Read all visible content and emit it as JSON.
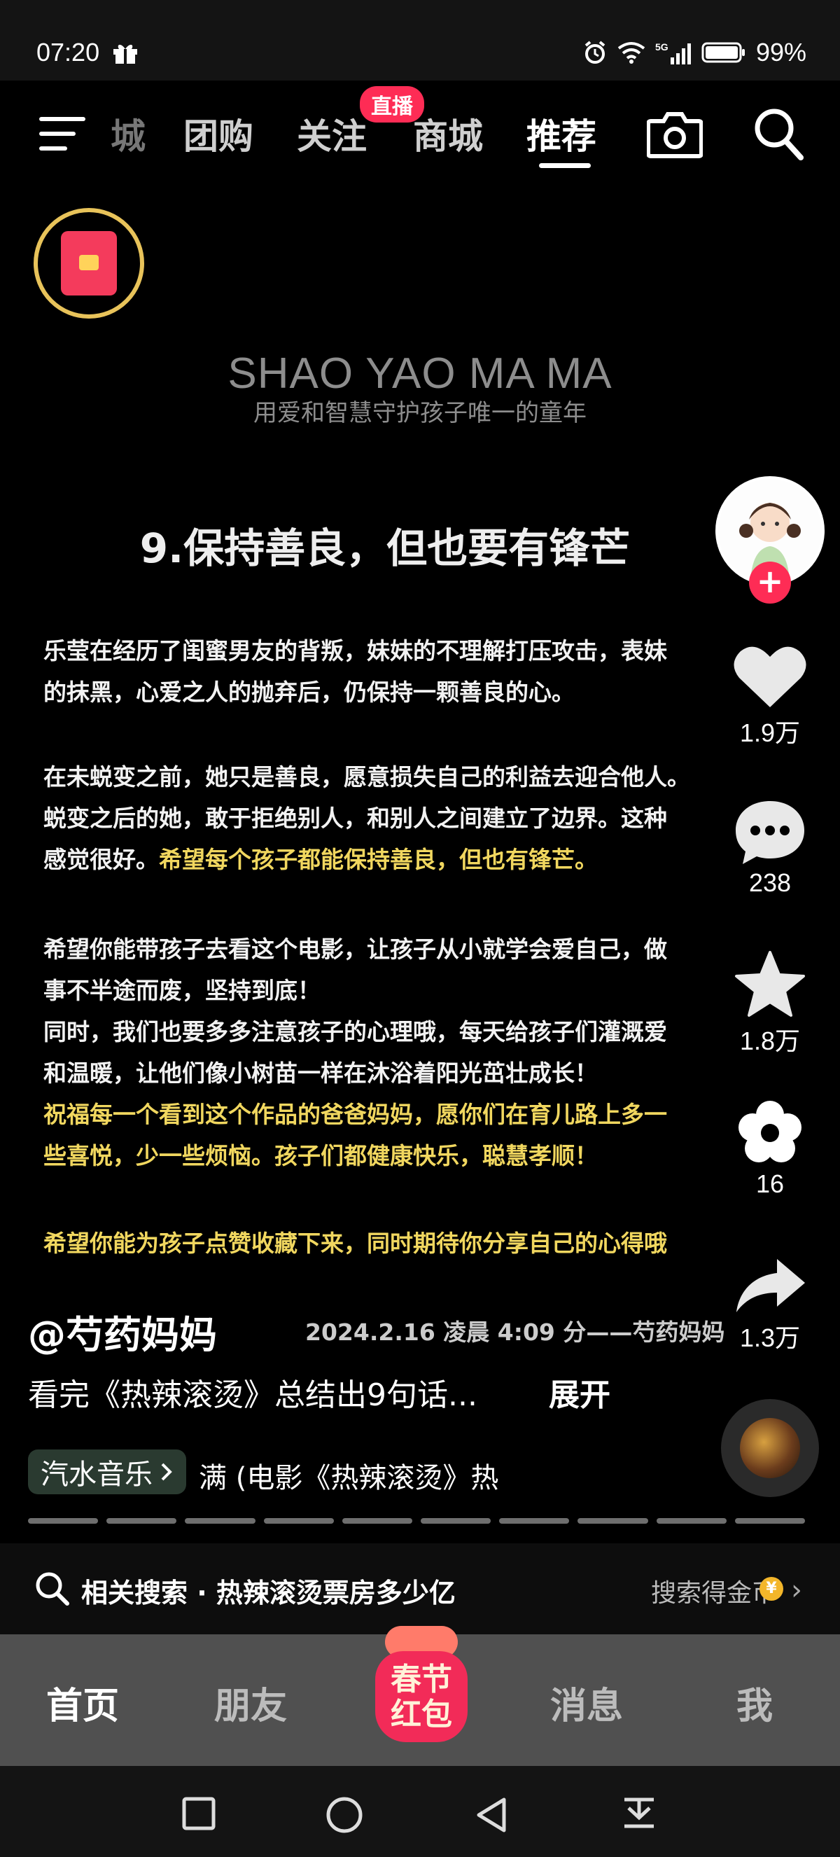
{
  "status_bar": {
    "time": "07:20",
    "battery": "99%",
    "network": "5G"
  },
  "top_nav": {
    "tabs": [
      "城",
      "团购",
      "关注",
      "商城",
      "推荐"
    ],
    "active_tab": "推荐",
    "live_badge": "直播"
  },
  "post": {
    "brand_title": "SHAO YAO MA MA",
    "brand_subtitle": "用爱和智慧守护孩子唯一的童年",
    "headline": "9.保持善良，但也要有锋芒",
    "p1_line1": "乐莹在经历了闺蜜男友的背叛，妹妹的不理解打压攻击，表妹",
    "p1_line2": "的抹黑，心爱之人的抛弃后，仍保持一颗善良的心。",
    "p2_line1": "在未蜕变之前，她只是善良，愿意损失自己的利益去迎合他人。",
    "p2_line2": "蜕变之后的她，敢于拒绝别人，和别人之间建立了边界。这种",
    "p2_line3a": "感觉很好。",
    "p2_line3b": "希望每个孩子都能保持善良，但也有锋芒。",
    "p3_line1": "希望你能带孩子去看这个电影，让孩子从小就学会爱自己，做",
    "p3_line2": "事不半途而废，坚持到底！",
    "p3_line3": "同时，我们也要多多注意孩子的心理哦，每天给孩子们灌溉爱",
    "p3_line4": "和温暖，让他们像小树苗一样在沐浴着阳光茁壮成长！",
    "p3_line5": "祝福每一个看到这个作品的爸爸妈妈，愿你们在育儿路上多一",
    "p3_line6": "些喜悦，少一些烦恼。孩子们都健康快乐，聪慧孝顺！",
    "p4_line1": "希望你能为孩子点赞收藏下来，同时期待你分享自己的心得哦",
    "author": "@芍药妈妈",
    "stamp": "2024.2.16  凌晨 4:09 分——芍药妈妈",
    "caption": "看完《热辣滚烫》总结出9句话...",
    "expand": "展开",
    "music_app": "汽水音乐",
    "music_title": "满 (电影《热辣滚烫》热"
  },
  "actions": {
    "likes": "1.9万",
    "comments": "238",
    "favorites": "1.8万",
    "recommend": "16",
    "shares": "1.3万"
  },
  "related": {
    "text": "相关搜索 · 热辣滚烫票房多少亿",
    "reward": "搜索得金币",
    "coin": "¥"
  },
  "tabbar": {
    "home": "首页",
    "friends": "朋友",
    "spring_line1": "春节",
    "spring_line2": "红包",
    "messages": "消息",
    "me": "我"
  },
  "colors": {
    "accent": "#fe2c55",
    "highlight": "#f1d75f",
    "ring": "#e8c35a"
  }
}
